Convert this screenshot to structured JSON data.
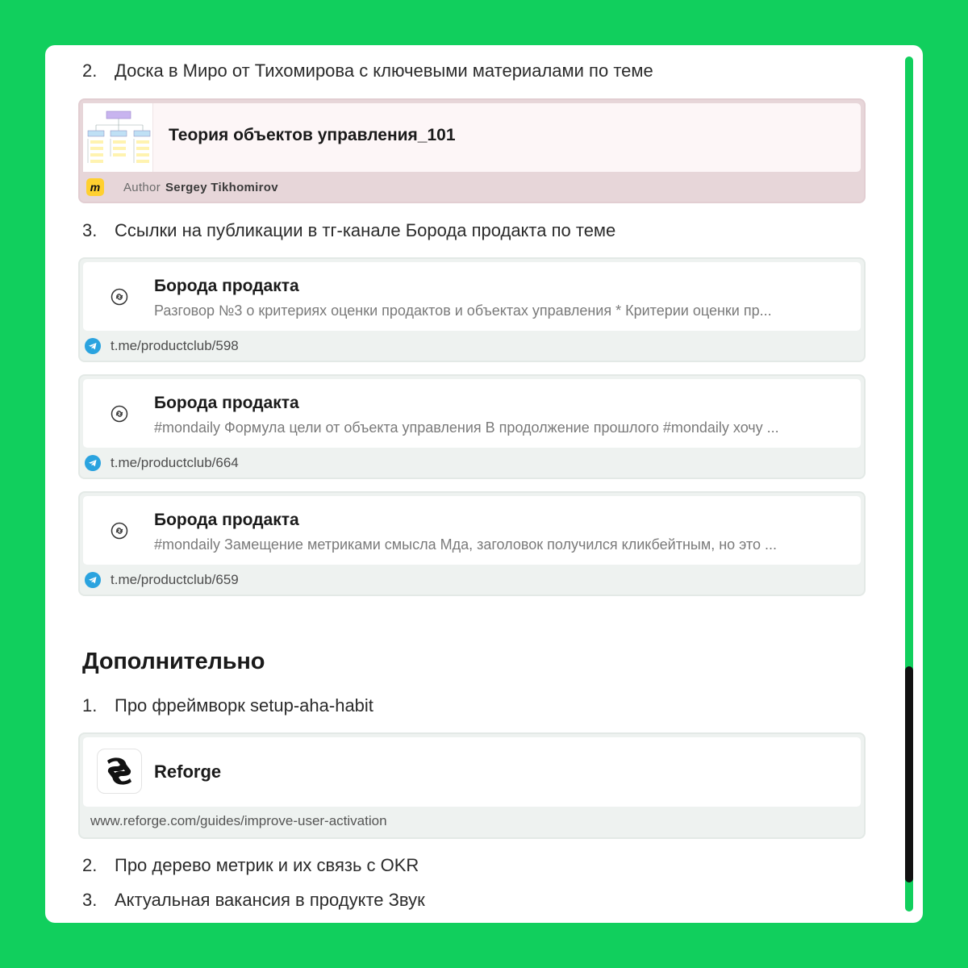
{
  "list1": [
    {
      "num": "2.",
      "text": "Доска в Миро от Тихомирова с ключевыми материалами по теме"
    },
    {
      "num": "3.",
      "text": "Ссылки на публикации в тг-канале Борода продакта по теме"
    }
  ],
  "miro_card": {
    "title": "Теория объектов управления_101",
    "logo": "m",
    "author_label": "Author",
    "author_name": "Sergey Tikhomirov"
  },
  "tg_cards": [
    {
      "title": "Борода продакта",
      "desc": "Разговор №3 о критериях оценки продактов и объектах управления * Критерии оценки пр...",
      "url": "t.me/productclub/598"
    },
    {
      "title": "Борода продакта",
      "desc": "#mondaily Формула цели от объекта управления В продолжение прошлого #mondaily хочу ...",
      "url": "t.me/productclub/664"
    },
    {
      "title": "Борода продакта",
      "desc": "#mondaily Замещение метриками смысла Мда, заголовок получился кликбейтным, но это ...",
      "url": "t.me/productclub/659"
    }
  ],
  "section_heading": "Дополнительно",
  "list2": [
    {
      "num": "1.",
      "text": "Про фреймворк setup-aha-habit"
    },
    {
      "num": "2.",
      "text": "Про дерево метрик и их связь с OKR"
    },
    {
      "num": "3.",
      "text": "Актуальная вакансия в продукте Звук"
    }
  ],
  "reforge_card": {
    "title": "Reforge",
    "url": "www.reforge.com/guides/improve-user-activation"
  },
  "colors": {
    "background": "#11cf5d",
    "miro_card_bg": "#e7d6d9",
    "link_card_bg": "#eef2f0",
    "telegram": "#2aa3df",
    "miro_yellow": "#ffd02f",
    "scrollbar_thumb": "#111111"
  }
}
